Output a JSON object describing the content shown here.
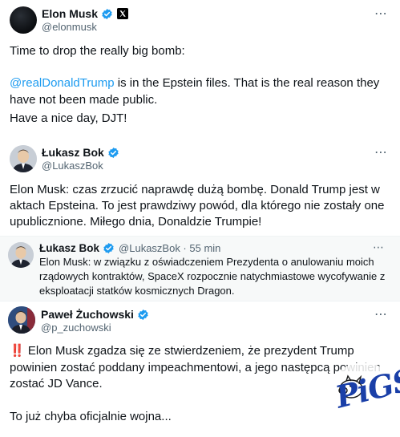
{
  "tweet1": {
    "name": "Elon Musk",
    "handle": "@elonmusk",
    "line1": "Time to drop the really big bomb:",
    "mention": "@realDonaldTrump",
    "line2_rest": " is in the Epstein files. That is the real reason they",
    "line3": "have not been made public.",
    "line4": "Have a nice day, DJT!",
    "icons": [
      "verified-badge-icon",
      "x-logo-icon",
      "more-options-icon"
    ]
  },
  "tweet2": {
    "name": "Łukasz Bok",
    "handle": "@LukaszBok",
    "line1": "Elon Musk: czas zrzucić naprawdę dużą bombę. Donald Trump jest w",
    "line2": "aktach Epsteina. To jest prawdziwy powód, dla którego nie zostały one",
    "line3": "upublicznione. Miłego dnia, Donaldzie Trumpie!"
  },
  "tweet3": {
    "name": "Łukasz Bok",
    "handle_time": "@LukaszBok · 55 min",
    "line1": "Elon Musk: w związku z oświadczeniem Prezydenta o anulowaniu moich",
    "line2": "rządowych kontraktów, SpaceX rozpocznie natychmiastowe wycofywanie z",
    "line3": "eksploatacji statków kosmicznych Dragon."
  },
  "tweet4": {
    "name": "Paweł Żuchowski",
    "handle": "@p_zuchowski",
    "line1_emoji": "‼️",
    "line1": " Elon Musk zgadza się ze stwierdzeniem, że prezydent Trump",
    "line2": "powinien zostać poddany impeachmentowi, a jego następcą powinien",
    "line3": "zostać JD Vance.",
    "line4": "To już chyba oficjalnie wojna..."
  },
  "watermark": {
    "text": "PiGS",
    "icon": "pig-logo-icon"
  },
  "colors": {
    "verified": "#1d9bf0",
    "mention": "#1d9bf0",
    "secondary_text": "#536471",
    "watermark": "#1a3fa8"
  }
}
